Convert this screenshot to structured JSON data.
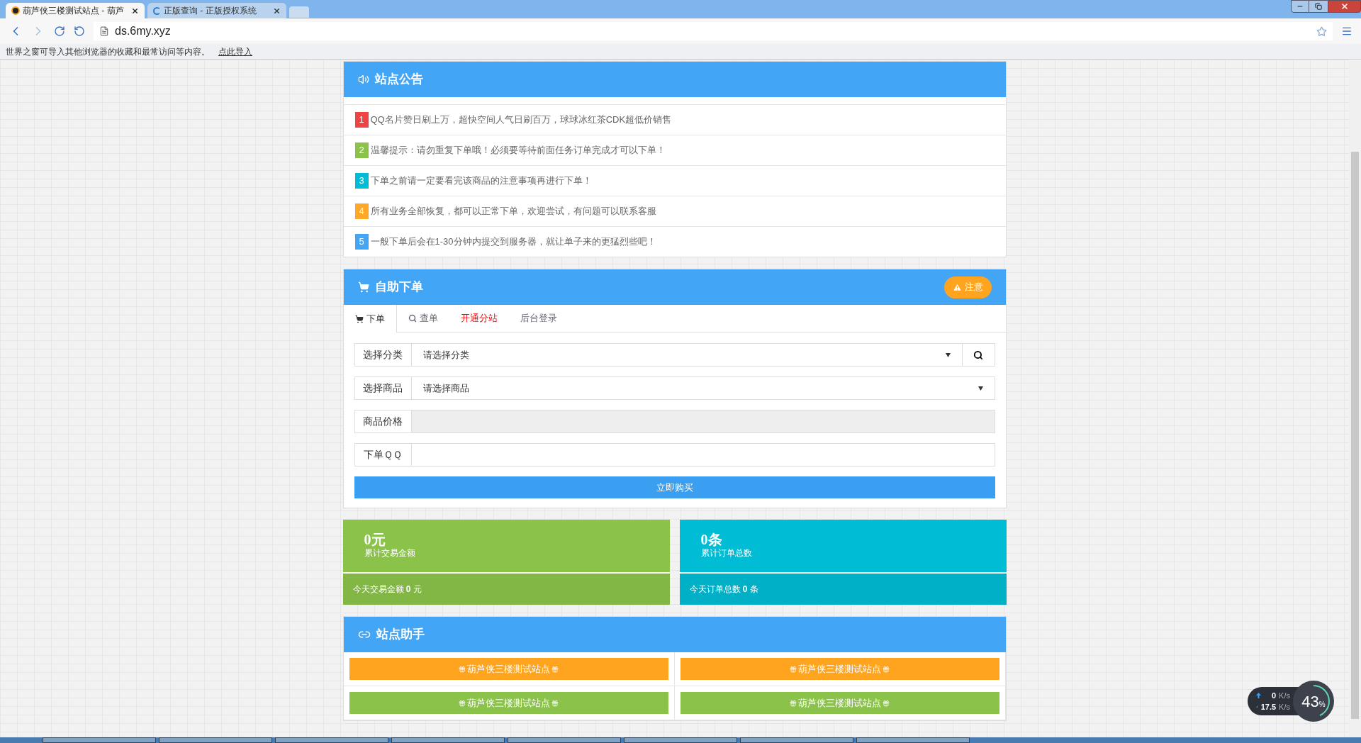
{
  "browser": {
    "tabs": [
      {
        "title": "葫芦侠三楼测试站点 - 葫芦",
        "selected": true
      },
      {
        "title": "正版查询 - 正版授权系统",
        "selected": false
      }
    ],
    "url": "ds.6my.xyz",
    "infobar": {
      "message": "世界之窗可导入其他浏览器的收藏和最常访问等内容。",
      "link": "点此导入"
    }
  },
  "announcement": {
    "title": "站点公告",
    "items": [
      {
        "number": "1",
        "color": "#ef4444",
        "text": "QQ名片赞日刷上万，超快空间人气日刷百万，球球冰红茶CDK超低价销售"
      },
      {
        "number": "2",
        "color": "#8bc34a",
        "text": "温馨提示：请勿重复下单哦！必须要等待前面任务订单完成才可以下单！"
      },
      {
        "number": "3",
        "color": "#00bcd4",
        "text": "下单之前请一定要看完该商品的注意事项再进行下单！"
      },
      {
        "number": "4",
        "color": "#ffa726",
        "text": "所有业务全部恢复，都可以正常下单，欢迎尝试，有问题可以联系客服"
      },
      {
        "number": "5",
        "color": "#42a5f5",
        "text": "一般下单后会在1-30分钟内提交到服务器，就让单子来的更猛烈些吧！"
      }
    ]
  },
  "order": {
    "title": "自助下单",
    "notice_button": "注意",
    "tabs": [
      {
        "label": "下单",
        "selected": true,
        "emphasized": false
      },
      {
        "label": "查单",
        "selected": false,
        "emphasized": false
      },
      {
        "label": "开通分站",
        "selected": false,
        "emphasized": true
      },
      {
        "label": "后台登录",
        "selected": false,
        "emphasized": false
      }
    ],
    "fields": [
      {
        "kind": "search_select",
        "label": "选择分类",
        "value": "请选择分类"
      },
      {
        "kind": "select",
        "label": "选择商品",
        "value": "请选择商品"
      },
      {
        "kind": "readonly",
        "label": "商品价格"
      },
      {
        "kind": "input",
        "label": "下单ＱＱ"
      }
    ],
    "submit": "立即购买"
  },
  "stats": [
    {
      "value": "0元",
      "label": "累计交易金额",
      "footer_prefix": "今天交易金额",
      "footer_value": "0",
      "footer_unit": "元",
      "color": "#8bc34a"
    },
    {
      "value": "0条",
      "label": "累计订单总数",
      "footer_prefix": "今天订单总数",
      "footer_value": "0",
      "footer_unit": "条",
      "color": "#00bcd4"
    }
  ],
  "helper": {
    "title": "站点助手",
    "links": [
      {
        "text": "葫芦侠三楼测试站点",
        "color": "#ffa41f"
      },
      {
        "text": "葫芦侠三楼测试站点",
        "color": "#ffa41f"
      },
      {
        "text": "葫芦侠三楼测试站点",
        "color": "#8bc34a"
      },
      {
        "text": "葫芦侠三楼测试站点",
        "color": "#8bc34a"
      }
    ]
  },
  "net_widget": {
    "upload": "0",
    "upload_unit": "K/s",
    "download": "17.5",
    "download_unit": "K/s",
    "percent": "43",
    "percent_unit": "%",
    "level": 0.43
  }
}
